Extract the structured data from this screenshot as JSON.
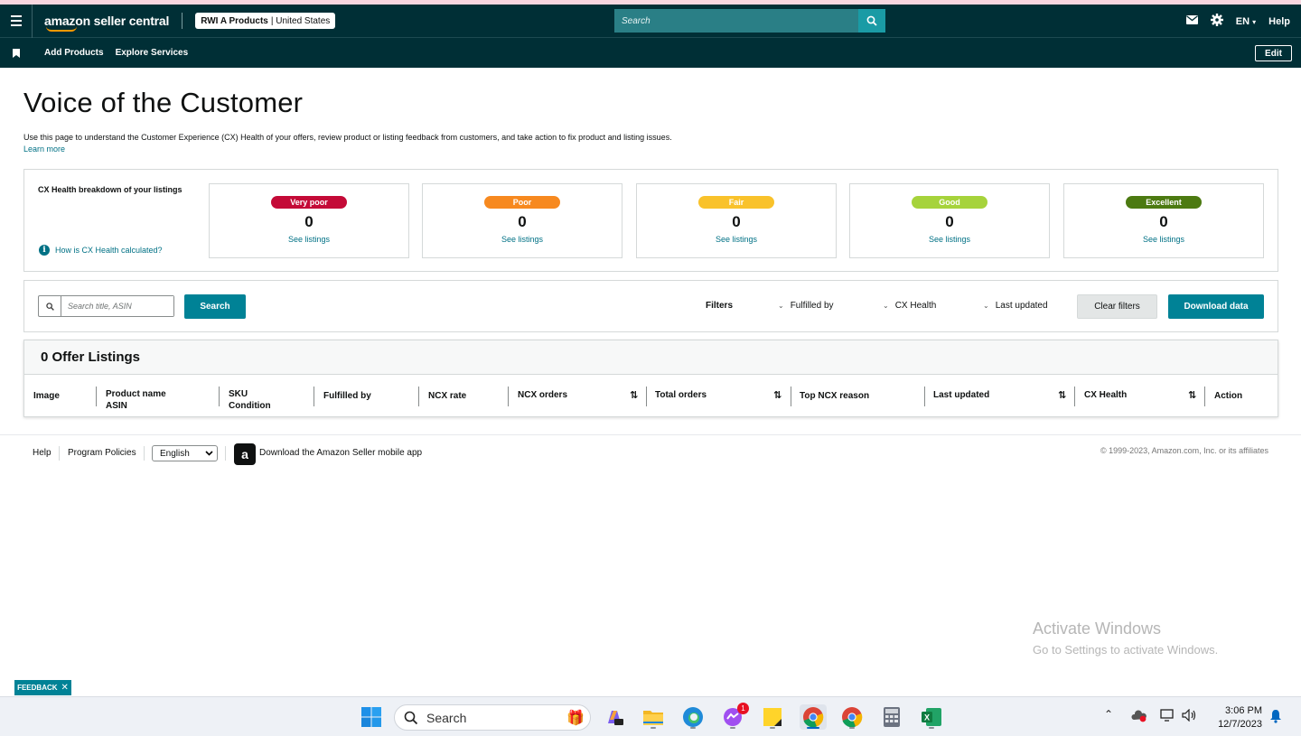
{
  "header": {
    "logo_text": "amazon seller central",
    "account_name": "RWI A Products",
    "account_region": "| United States",
    "search_placeholder": "Search",
    "language": "EN",
    "help": "Help"
  },
  "nav": {
    "items": [
      "Add Products",
      "Explore Services"
    ],
    "edit": "Edit"
  },
  "page": {
    "title": "Voice of the Customer",
    "description": "Use this page to understand the Customer Experience (CX) Health of your offers, review product or listing feedback from customers, and take action to fix product and listing issues.",
    "learn_more": "Learn more"
  },
  "health": {
    "title": "CX Health breakdown of your listings",
    "calc_link": "How is CX Health calculated?",
    "cards": [
      {
        "label": "Very poor",
        "count": "0",
        "link": "See listings",
        "color": "#c40a37"
      },
      {
        "label": "Poor",
        "count": "0",
        "link": "See listings",
        "color": "#f7891f"
      },
      {
        "label": "Fair",
        "count": "0",
        "link": "See listings",
        "color": "#f9c22b"
      },
      {
        "label": "Good",
        "count": "0",
        "link": "See listings",
        "color": "#a6d33b"
      },
      {
        "label": "Excellent",
        "count": "0",
        "link": "See listings",
        "color": "#4c7a11"
      }
    ]
  },
  "filters": {
    "search_placeholder": "Search title, ASIN",
    "search_button": "Search",
    "label": "Filters",
    "dropdowns": [
      "Fulfilled by",
      "CX Health",
      "Last updated"
    ],
    "clear": "Clear filters",
    "download": "Download data"
  },
  "table": {
    "title": "0 Offer Listings",
    "columns": {
      "image": "Image",
      "product_name": "Product name",
      "asin": "ASIN",
      "sku": "SKU",
      "condition": "Condition",
      "fulfilled_by": "Fulfilled by",
      "ncx_rate": "NCX rate",
      "ncx_orders": "NCX orders",
      "total_orders": "Total orders",
      "top_ncx_reason": "Top NCX reason",
      "last_updated": "Last updated",
      "cx_health": "CX Health",
      "action": "Action"
    }
  },
  "footer": {
    "help": "Help",
    "policies": "Program Policies",
    "language": "English",
    "app_link": "Download the Amazon Seller mobile app",
    "copyright": "© 1999-2023, Amazon.com, Inc. or its affiliates"
  },
  "watermark": {
    "line1": "Activate Windows",
    "line2": "Go to Settings to activate Windows."
  },
  "feedback": "FEEDBACK",
  "taskbar": {
    "search": "Search",
    "time": "3:06 PM",
    "date": "12/7/2023",
    "messenger_badge": "1"
  }
}
